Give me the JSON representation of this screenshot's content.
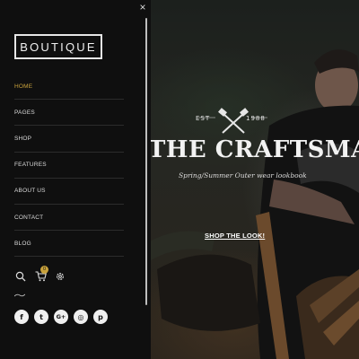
{
  "sidebar": {
    "logo_text": "BOUTIQUE",
    "close_symbol": "×",
    "menu": [
      {
        "label": "HOME",
        "active": true
      },
      {
        "label": "PAGES",
        "active": false
      },
      {
        "label": "SHOP",
        "active": false
      },
      {
        "label": "FEATURES",
        "active": false
      },
      {
        "label": "ABOUT US",
        "active": false
      },
      {
        "label": "CONTACT",
        "active": false
      },
      {
        "label": "BLOG",
        "active": false
      }
    ],
    "tools": {
      "search_icon": "search-icon",
      "cart_icon": "cart-icon",
      "cart_count": "0",
      "settings_icon": "gear-icon"
    },
    "social": [
      {
        "icon": "facebook-icon",
        "glyph": "f"
      },
      {
        "icon": "twitter-icon",
        "glyph": "t"
      },
      {
        "icon": "google-plus-icon",
        "glyph": "G+"
      },
      {
        "icon": "instagram-icon",
        "glyph": "◎"
      },
      {
        "icon": "pinterest-icon",
        "glyph": "p"
      }
    ]
  },
  "hero": {
    "est_left": "EST",
    "est_right": "1988",
    "title": "THE CRAFTSMAN",
    "subtitle": "Spring/Summer Outer wear lookbook",
    "cta": "SHOP THE LOOK!"
  },
  "colors": {
    "accent": "#c9a23b",
    "sidebar_bg": "#0f0f0f",
    "text": "#dcdcdc"
  }
}
